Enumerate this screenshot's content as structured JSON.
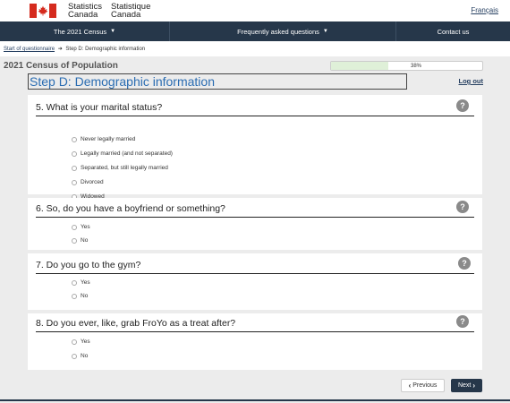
{
  "header": {
    "brand_en_line1": "Statistics",
    "brand_en_line2": "Canada",
    "brand_fr_line1": "Statistique",
    "brand_fr_line2": "Canada",
    "language_link": "Français",
    "flag_icon": "canada-flag-icon"
  },
  "nav": {
    "items": [
      {
        "label": "The 2021 Census",
        "icon": "chevron-down-icon"
      },
      {
        "label": "Frequently asked questions",
        "icon": "chevron-down-icon"
      },
      {
        "label": "Contact us"
      }
    ]
  },
  "breadcrumb": {
    "link": "Start of questionnaire",
    "separator": "➜",
    "current": "Step D: Demographic information"
  },
  "questionnaire": {
    "title": "2021 Census of Population",
    "progress_percent": 38,
    "progress_label": "38%",
    "step_title": "Step D: Demographic information",
    "logout": "Log out"
  },
  "questions": [
    {
      "title": "5. What is your marital status?",
      "options": [
        "Never legally married",
        "Legally married (and not separated)",
        "Separated, but still legally married",
        "Divorced",
        "Widowed"
      ]
    },
    {
      "title": "6. So, do you have a boyfriend or something?",
      "options": [
        "Yes",
        "No"
      ]
    },
    {
      "title": "7. Do you go to the gym?",
      "options": [
        "Yes",
        "No"
      ]
    },
    {
      "title": "8. Do you ever, like, grab FroYo as a treat after?",
      "options": [
        "Yes",
        "No"
      ]
    }
  ],
  "help_icon": "?",
  "buttons": {
    "previous": "Previous",
    "next": "Next"
  },
  "colors": {
    "nav_bg": "#26374a",
    "step_title": "#2b6db2",
    "progress_fill": "#dff0d8",
    "flag_red": "#d52b1e"
  }
}
